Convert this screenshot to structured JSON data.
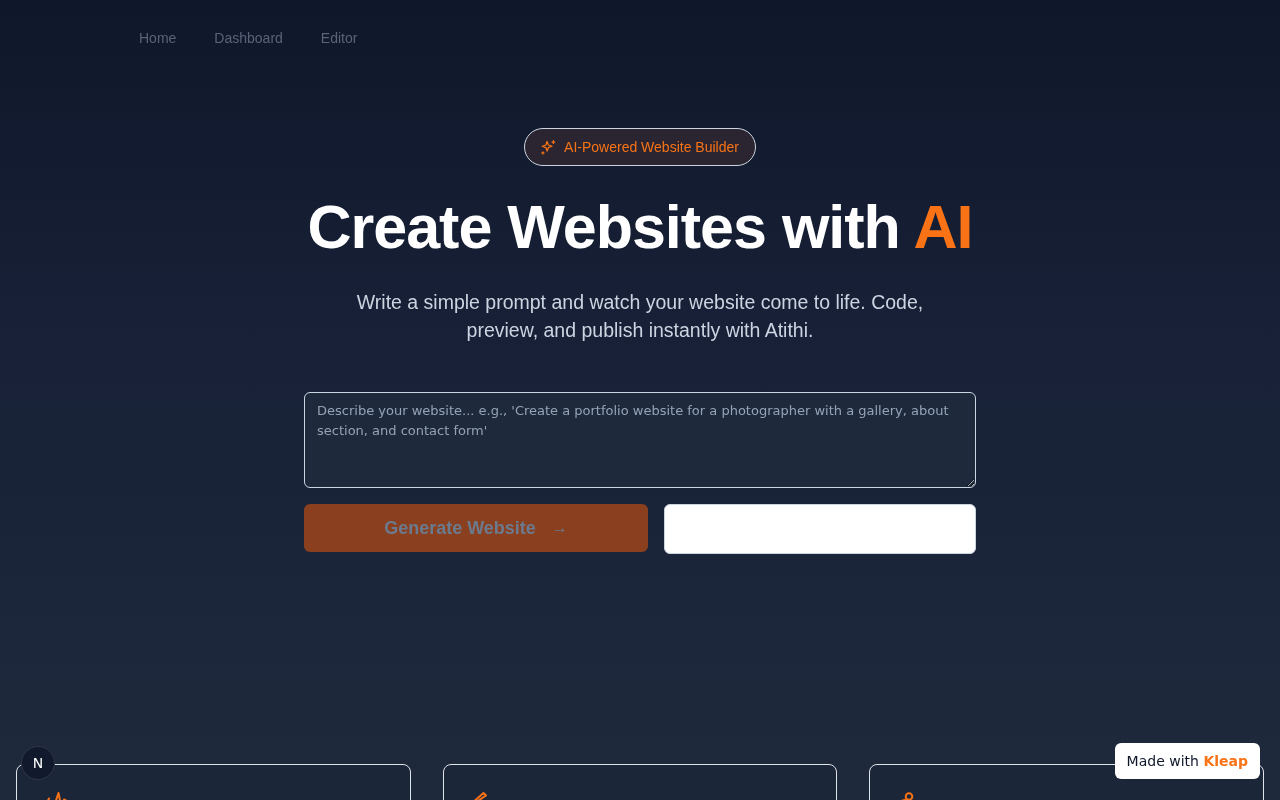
{
  "nav": {
    "links": [
      {
        "label": "Home"
      },
      {
        "label": "Dashboard"
      },
      {
        "label": "Editor"
      }
    ]
  },
  "hero": {
    "badge": {
      "label": "AI-Powered Website Builder"
    },
    "title": "Create Websites with",
    "title_highlight": "AI",
    "subtitle": "Write a simple prompt and watch your website come to life. Code, preview, and publish instantly with Atithi."
  },
  "prompt": {
    "placeholder": "Describe your website... e.g., 'Create a portfolio website for a photographer with a gallery, about section, and contact form'"
  },
  "generate_button": {
    "label": "Generate Website",
    "arrow": "→",
    "disabled": true
  },
  "dev_badge": {
    "label": "N"
  },
  "made_with": {
    "text": "Made with",
    "brand": "Kleap"
  }
}
